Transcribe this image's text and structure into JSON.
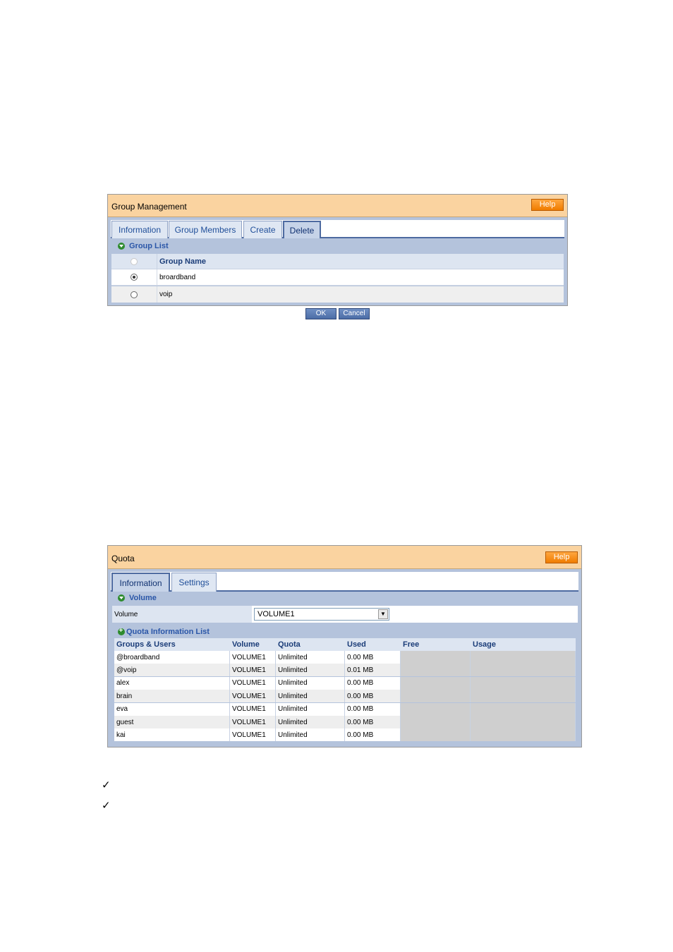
{
  "group_management": {
    "title": "Group Management",
    "help_label": "Help",
    "tabs": [
      {
        "label": "Information"
      },
      {
        "label": "Group Members"
      },
      {
        "label": "Create"
      },
      {
        "label": "Delete",
        "active": true
      }
    ],
    "section_label": "Group List",
    "column_header": "Group Name",
    "rows": [
      {
        "name": "broardband",
        "selected": true
      },
      {
        "name": "voip",
        "selected": false
      }
    ],
    "ok_label": "OK",
    "cancel_label": "Cancel"
  },
  "quota": {
    "title": "Quota",
    "help_label": "Help",
    "tabs": [
      {
        "label": "Information",
        "active": true
      },
      {
        "label": "Settings"
      }
    ],
    "volume_section_label": "Volume",
    "volume_field_label": "Volume",
    "volume_selected": "VOLUME1",
    "list_section_label": "Quota Information List",
    "columns": [
      "Groups & Users",
      "Volume",
      "Quota",
      "Used",
      "Free",
      "Usage"
    ],
    "rows": [
      [
        "@broardband",
        "VOLUME1",
        "Unlimited",
        "0.00 MB",
        "",
        ""
      ],
      [
        "@voip",
        "VOLUME1",
        "Unlimited",
        "0.01 MB",
        "",
        ""
      ],
      [
        "alex",
        "VOLUME1",
        "Unlimited",
        "0.00 MB",
        "",
        ""
      ],
      [
        "brain",
        "VOLUME1",
        "Unlimited",
        "0.00 MB",
        "",
        ""
      ],
      [
        "eva",
        "VOLUME1",
        "Unlimited",
        "0.00 MB",
        "",
        ""
      ],
      [
        "guest",
        "VOLUME1",
        "Unlimited",
        "0.00 MB",
        "",
        ""
      ],
      [
        "kai",
        "VOLUME1",
        "Unlimited",
        "0.00 MB",
        "",
        ""
      ]
    ]
  },
  "checklist": [
    {
      "icon": "checkmark-icon",
      "glyph": "✓"
    },
    {
      "icon": "checkmark-icon",
      "glyph": "✓"
    }
  ],
  "colors": {
    "header_bg": "#fad3a0",
    "help_button": "#f07c00",
    "panel_bg": "#b4c3dc",
    "tab_text": "#1f4e99",
    "section_icon": "#2e8b2e"
  }
}
